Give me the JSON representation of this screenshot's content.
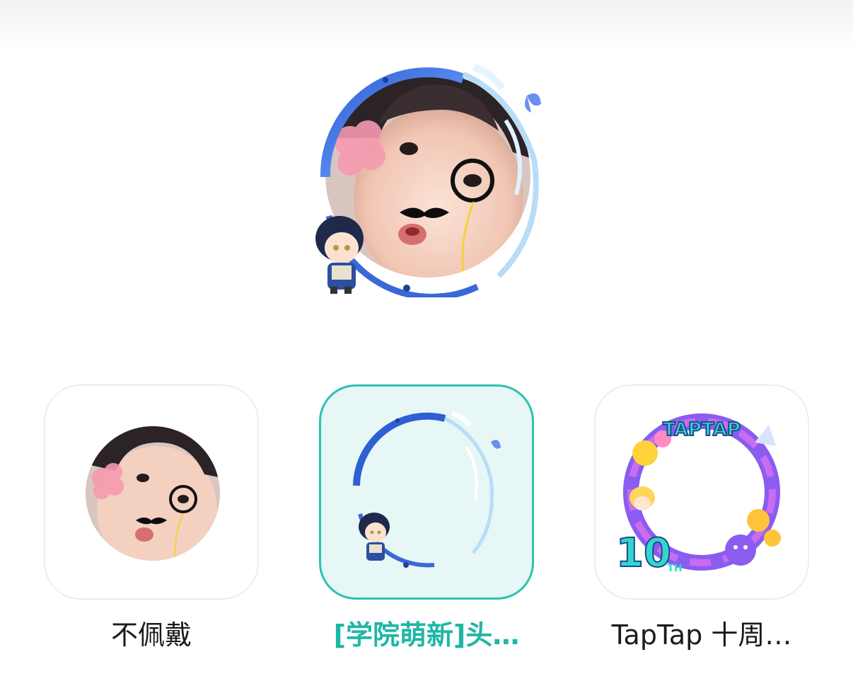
{
  "preview": {
    "icon": "avatar-with-academy-frame"
  },
  "frames": [
    {
      "label": "不佩戴",
      "selected": false,
      "icon": "avatar-photo"
    },
    {
      "label": "[学院萌新]头…",
      "selected": true,
      "icon": "academy-frame"
    },
    {
      "label": "TapTap 十周…",
      "selected": false,
      "icon": "taptap-10th-frame"
    }
  ],
  "tap10": {
    "logo_text": "TAPTAP",
    "number": "10",
    "suffix": "TH"
  },
  "colors": {
    "accent": "#2cc2b3",
    "accent_text": "#1fb7a6",
    "selected_bg": "#e6f7f6",
    "frame_blue": "#3a68d8",
    "tap_purple": "#8a5cf0"
  }
}
